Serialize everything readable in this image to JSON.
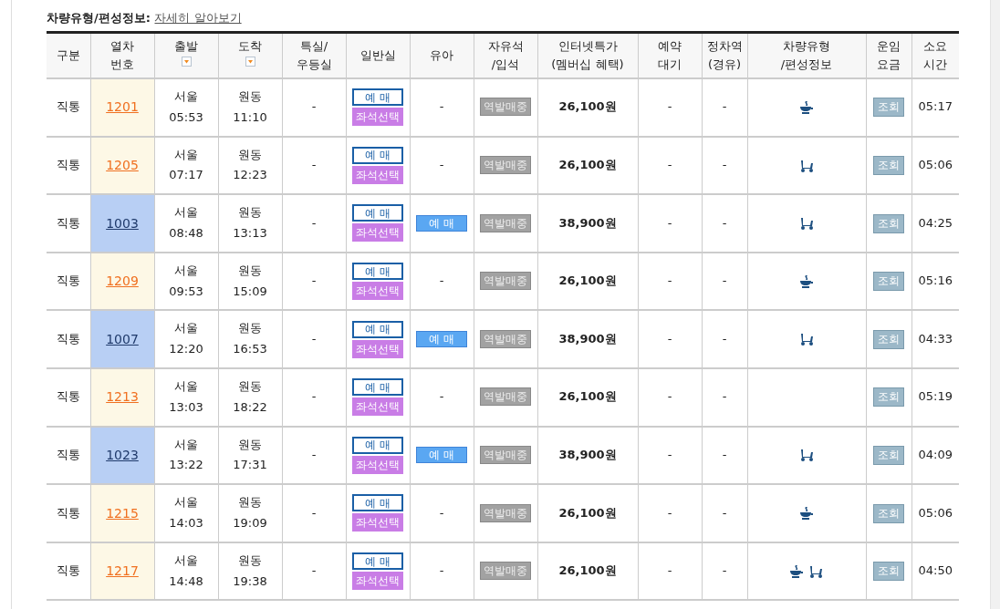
{
  "info_label": "차량유형/편성정보:",
  "info_link": "자세히 알아보기",
  "columns": [
    {
      "label": "구분",
      "sortable": false
    },
    {
      "label": "열차\n번호",
      "sortable": false
    },
    {
      "label": "출발",
      "sortable": true
    },
    {
      "label": "도착",
      "sortable": true
    },
    {
      "label": "특실/\n우등실",
      "sortable": false
    },
    {
      "label": "일반실",
      "sortable": false
    },
    {
      "label": "유아",
      "sortable": false
    },
    {
      "label": "자유석\n/입석",
      "sortable": false
    },
    {
      "label": "인터넷특가\n(멤버십 혜택)",
      "sortable": false
    },
    {
      "label": "예약\n대기",
      "sortable": false
    },
    {
      "label": "정차역\n(경유)",
      "sortable": false
    },
    {
      "label": "차량유형\n/편성정보",
      "sortable": false
    },
    {
      "label": "운임\n요금",
      "sortable": false
    },
    {
      "label": "소요\n시간",
      "sortable": false
    }
  ],
  "rows": [
    {
      "type": "직통",
      "train": "1201",
      "highlighted": false,
      "dep": "서울",
      "dep_time": "05:53",
      "arr": "원동",
      "arr_time": "11:10",
      "special": "-",
      "general": [
        "예 매",
        "좌석선택"
      ],
      "infant": {
        "kind": "text",
        "label": "-"
      },
      "standing": "역발매중",
      "price": "26,100원",
      "wait": "-",
      "stops": "-",
      "icons": [
        {
          "kind": "cup"
        }
      ],
      "fare": "조회",
      "duration": "05:17"
    },
    {
      "type": "직통",
      "train": "1205",
      "highlighted": false,
      "dep": "서울",
      "dep_time": "07:17",
      "arr": "원동",
      "arr_time": "12:23",
      "special": "-",
      "general": [
        "예 매",
        "좌석선택"
      ],
      "infant": {
        "kind": "text",
        "label": "-"
      },
      "standing": "역발매중",
      "price": "26,100원",
      "wait": "-",
      "stops": "-",
      "icons": [
        {
          "kind": "scooter"
        }
      ],
      "fare": "조회",
      "duration": "05:06"
    },
    {
      "type": "직통",
      "train": "1003",
      "highlighted": true,
      "dep": "서울",
      "dep_time": "08:48",
      "arr": "원동",
      "arr_time": "13:13",
      "special": "-",
      "general": [
        "예 매",
        "좌석선택"
      ],
      "infant": {
        "kind": "button",
        "label": "예 매"
      },
      "standing": "역발매중",
      "price": "38,900원",
      "wait": "-",
      "stops": "-",
      "icons": [
        {
          "kind": "scooter"
        }
      ],
      "fare": "조회",
      "duration": "04:25"
    },
    {
      "type": "직통",
      "train": "1209",
      "highlighted": false,
      "dep": "서울",
      "dep_time": "09:53",
      "arr": "원동",
      "arr_time": "15:09",
      "special": "-",
      "general": [
        "예 매",
        "좌석선택"
      ],
      "infant": {
        "kind": "text",
        "label": "-"
      },
      "standing": "역발매중",
      "price": "26,100원",
      "wait": "-",
      "stops": "-",
      "icons": [
        {
          "kind": "cup"
        }
      ],
      "fare": "조회",
      "duration": "05:16"
    },
    {
      "type": "직통",
      "train": "1007",
      "highlighted": true,
      "dep": "서울",
      "dep_time": "12:20",
      "arr": "원동",
      "arr_time": "16:53",
      "special": "-",
      "general": [
        "예 매",
        "좌석선택"
      ],
      "infant": {
        "kind": "button",
        "label": "예 매"
      },
      "standing": "역발매중",
      "price": "38,900원",
      "wait": "-",
      "stops": "-",
      "icons": [
        {
          "kind": "scooter"
        }
      ],
      "fare": "조회",
      "duration": "04:33"
    },
    {
      "type": "직통",
      "train": "1213",
      "highlighted": false,
      "dep": "서울",
      "dep_time": "13:03",
      "arr": "원동",
      "arr_time": "18:22",
      "special": "-",
      "general": [
        "예 매",
        "좌석선택"
      ],
      "infant": {
        "kind": "text",
        "label": "-"
      },
      "standing": "역발매중",
      "price": "26,100원",
      "wait": "-",
      "stops": "-",
      "icons": [],
      "fare": "조회",
      "duration": "05:19"
    },
    {
      "type": "직통",
      "train": "1023",
      "highlighted": true,
      "dep": "서울",
      "dep_time": "13:22",
      "arr": "원동",
      "arr_time": "17:31",
      "special": "-",
      "general": [
        "예 매",
        "좌석선택"
      ],
      "infant": {
        "kind": "button",
        "label": "예 매"
      },
      "standing": "역발매중",
      "price": "38,900원",
      "wait": "-",
      "stops": "-",
      "icons": [
        {
          "kind": "scooter"
        }
      ],
      "fare": "조회",
      "duration": "04:09"
    },
    {
      "type": "직통",
      "train": "1215",
      "highlighted": false,
      "dep": "서울",
      "dep_time": "14:03",
      "arr": "원동",
      "arr_time": "19:09",
      "special": "-",
      "general": [
        "예 매",
        "좌석선택"
      ],
      "infant": {
        "kind": "text",
        "label": "-"
      },
      "standing": "역발매중",
      "price": "26,100원",
      "wait": "-",
      "stops": "-",
      "icons": [
        {
          "kind": "cup"
        }
      ],
      "fare": "조회",
      "duration": "05:06"
    },
    {
      "type": "직통",
      "train": "1217",
      "highlighted": false,
      "dep": "서울",
      "dep_time": "14:48",
      "arr": "원동",
      "arr_time": "19:38",
      "special": "-",
      "general": [
        "예 매",
        "좌석선택"
      ],
      "infant": {
        "kind": "text",
        "label": "-"
      },
      "standing": "역발매중",
      "price": "26,100원",
      "wait": "-",
      "stops": "-",
      "icons": [
        {
          "kind": "cup"
        },
        {
          "kind": "scooter"
        }
      ],
      "fare": "조회",
      "duration": "04:50"
    }
  ]
}
